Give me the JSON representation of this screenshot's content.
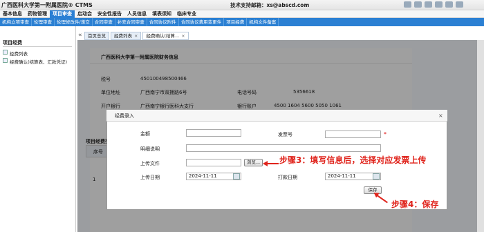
{
  "app": {
    "title": "广西医科大学第一附属医院® CTMS",
    "support": "技术支持邮箱：xs@abscd.com"
  },
  "menu": [
    "基本信息",
    "药物管理",
    "项目审查",
    "启动会",
    "安全性报告",
    "人员信息",
    "填表须知",
    "临床专业"
  ],
  "submenu": [
    "机构立项审查",
    "伦理审查",
    "伦理修改件/递交",
    "合同审查",
    "补充合同审查",
    "合同协议附件",
    "合同协议费用变更件",
    "项目经费",
    "机构文件备案"
  ],
  "sidebar": {
    "title": "项目经费",
    "items": [
      "经费列表",
      "经费确认(结算表、汇款凭证)"
    ]
  },
  "tabs": [
    {
      "label": "首页总览"
    },
    {
      "label": "经费列表"
    },
    {
      "label": "经费确认(结算..."
    }
  ],
  "hospital": {
    "name": "广西医科大学第一附属医院财务信息",
    "tax_label": "税号",
    "tax_value": "450100498500466",
    "address_label": "单位地址",
    "address_value": "广西南宁市双拥路6号",
    "phone_label": "电话号码",
    "phone_value": "5356618",
    "bank_label": "开户银行",
    "bank_value": "广西南宁银行医科大支行",
    "account_label": "银行账户",
    "account_value": "4500 1604 5600 5050 1061"
  },
  "section": {
    "title": "项目经费列",
    "col_seq": "序号",
    "row1": "1"
  },
  "dialog": {
    "title": "经费录入",
    "amount_label": "金额",
    "amount_value": "",
    "invoice_label": "发票号",
    "invoice_value": "",
    "required_mark": "*",
    "detail_label": "明细说明",
    "detail_value": "",
    "upload_label": "上传文件",
    "upload_value": "",
    "browse_label": "浏览...",
    "upload_date_label": "上传日期",
    "upload_date_value": "2024-11-11",
    "pay_date_label": "打款日期",
    "pay_date_value": "2024-11-11",
    "save_label": "保存"
  },
  "annotations": {
    "step3": "步骤3：填写信息后，选择对应发票上传",
    "step4": "步骤4：保存"
  },
  "colors": {
    "accent": "#2b80d3",
    "annotation": "#e0241c"
  }
}
